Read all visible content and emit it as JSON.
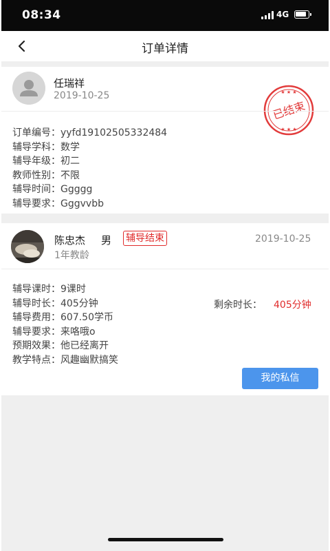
{
  "status_bar": {
    "time": "08:34",
    "network": "4G"
  },
  "nav": {
    "title": "订单详情",
    "back_icon": "chevron-left-icon"
  },
  "order": {
    "student_name": "任瑞祥",
    "date": "2019-10-25",
    "stamp_text": "已结束",
    "fields": [
      {
        "label": "订单编号：",
        "value": "yyfd19102505332484"
      },
      {
        "label": "辅导学科：",
        "value": "数学"
      },
      {
        "label": "辅导年级：",
        "value": "初二"
      },
      {
        "label": "教师性别：",
        "value": "不限"
      },
      {
        "label": "辅导时间：",
        "value": "Ggggg"
      },
      {
        "label": "辅导要求：",
        "value": "Gggvvbb"
      }
    ]
  },
  "tutor": {
    "name": "陈忠杰",
    "gender": "男",
    "status_badge": "辅导结束",
    "date": "2019-10-25",
    "experience": "1年教龄",
    "fields": [
      {
        "label": "辅导课时：",
        "value": "9课时"
      },
      {
        "label": "辅导时长：",
        "value": "405分钟"
      },
      {
        "label": "辅导费用：",
        "value": "607.50学币"
      },
      {
        "label": "辅导要求：",
        "value": "来咯哦o"
      },
      {
        "label": "预期效果：",
        "value": "他已经离开"
      },
      {
        "label": "教学特点：",
        "value": "风趣幽默搞笑"
      }
    ],
    "remaining_label": "剩余时长：",
    "remaining_value": "405分钟",
    "message_button": "我的私信"
  },
  "colors": {
    "accent_red": "#e02b2b",
    "button_blue": "#4c95ec",
    "status_bar_bg": "#0a0a0a"
  }
}
